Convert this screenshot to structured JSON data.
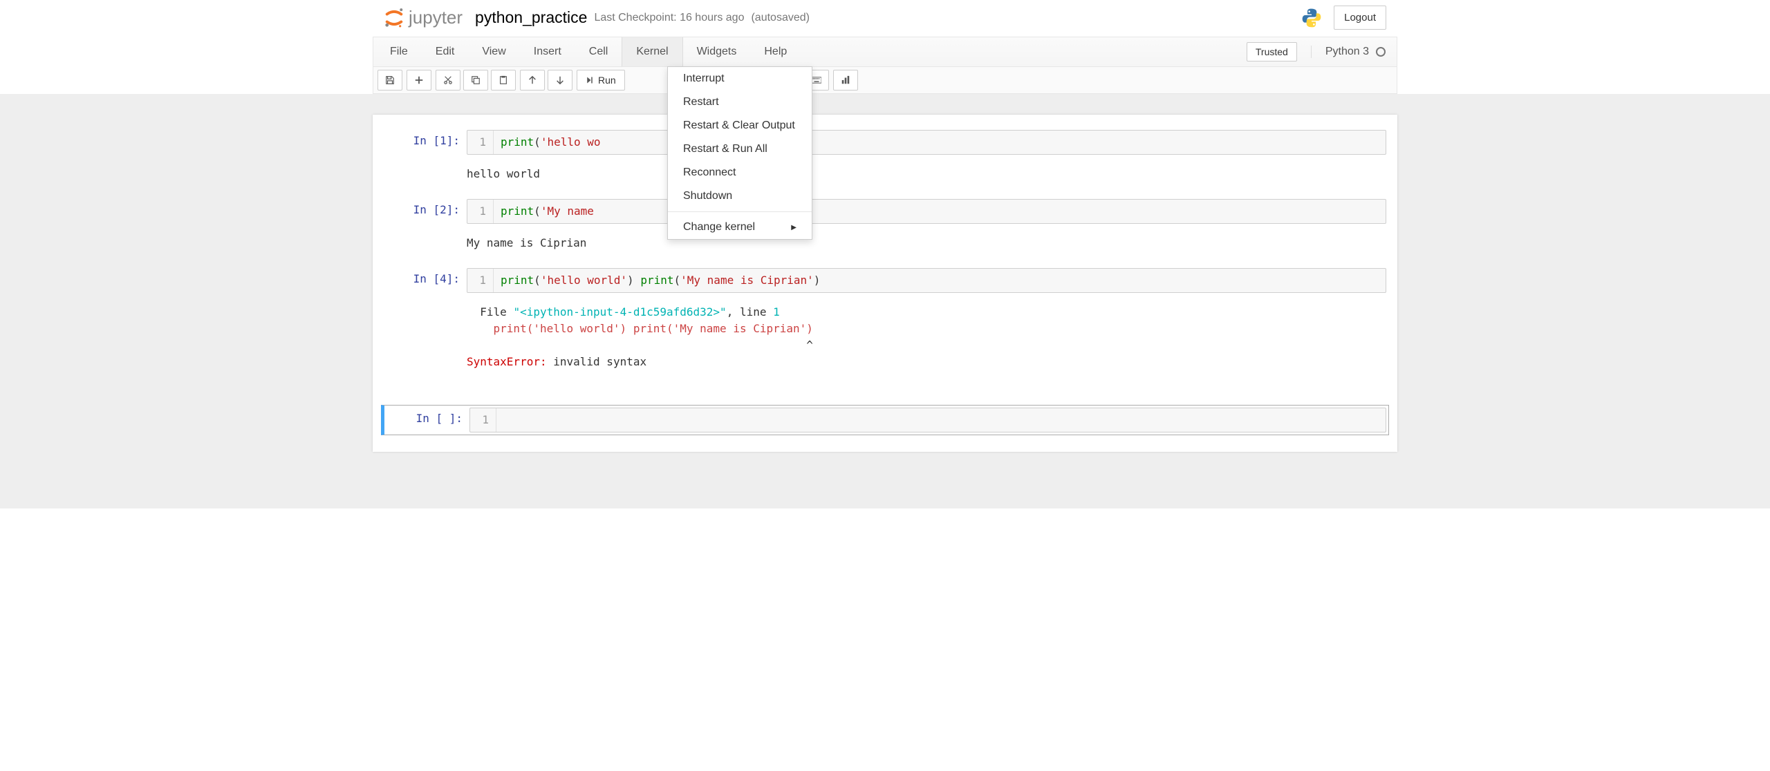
{
  "header": {
    "logo_text": "jupyter",
    "notebook_name": "python_practice",
    "checkpoint": "Last Checkpoint: 16 hours ago",
    "autosaved": "(autosaved)",
    "logout": "Logout"
  },
  "menubar": {
    "items": [
      "File",
      "Edit",
      "View",
      "Insert",
      "Cell",
      "Kernel",
      "Widgets",
      "Help"
    ],
    "active_index": 5,
    "trusted": "Trusted",
    "kernel_name": "Python 3"
  },
  "kernel_menu": {
    "items": [
      "Interrupt",
      "Restart",
      "Restart & Clear Output",
      "Restart & Run All",
      "Reconnect",
      "Shutdown"
    ],
    "submenu": "Change kernel"
  },
  "toolbar": {
    "run_label": "Run"
  },
  "cells": [
    {
      "prompt": "In [1]:",
      "lineno": "1",
      "code_html": "<span class=\"cm-keyword\">print</span><span class=\"cm-paren\">(</span><span class=\"cm-string\">'hello wo</span>",
      "output": "hello world"
    },
    {
      "prompt": "In [2]:",
      "lineno": "1",
      "code_html": "<span class=\"cm-keyword\">print</span><span class=\"cm-paren\">(</span><span class=\"cm-string\">'My name </span>",
      "output": "My name is Ciprian"
    },
    {
      "prompt": "In [4]:",
      "lineno": "1",
      "code_html": "<span class=\"cm-keyword\">print</span><span class=\"cm-paren\">(</span><span class=\"cm-string\">'hello world'</span><span class=\"cm-paren\">)</span> <span class=\"cm-keyword\">print</span><span class=\"cm-paren\">(</span><span class=\"cm-string\">'My name is Ciprian'</span><span class=\"cm-paren\">)</span>",
      "error": {
        "file_line": "  File <span class=\"err-file\">\"&lt;ipython-input-4-d1c59afd6d32&gt;\"</span>, line <span class=\"err-line\">1</span>",
        "code_line": "    <span class=\"err-code\">print('hello world') print('My name is Ciprian')</span>",
        "caret_line": "                                                   ^",
        "msg": "<span class=\"err-name\">SyntaxError</span><span class=\"err-name\">:</span> invalid syntax"
      }
    },
    {
      "prompt": "In [ ]:",
      "lineno": "1",
      "code_html": "",
      "selected": true
    }
  ]
}
